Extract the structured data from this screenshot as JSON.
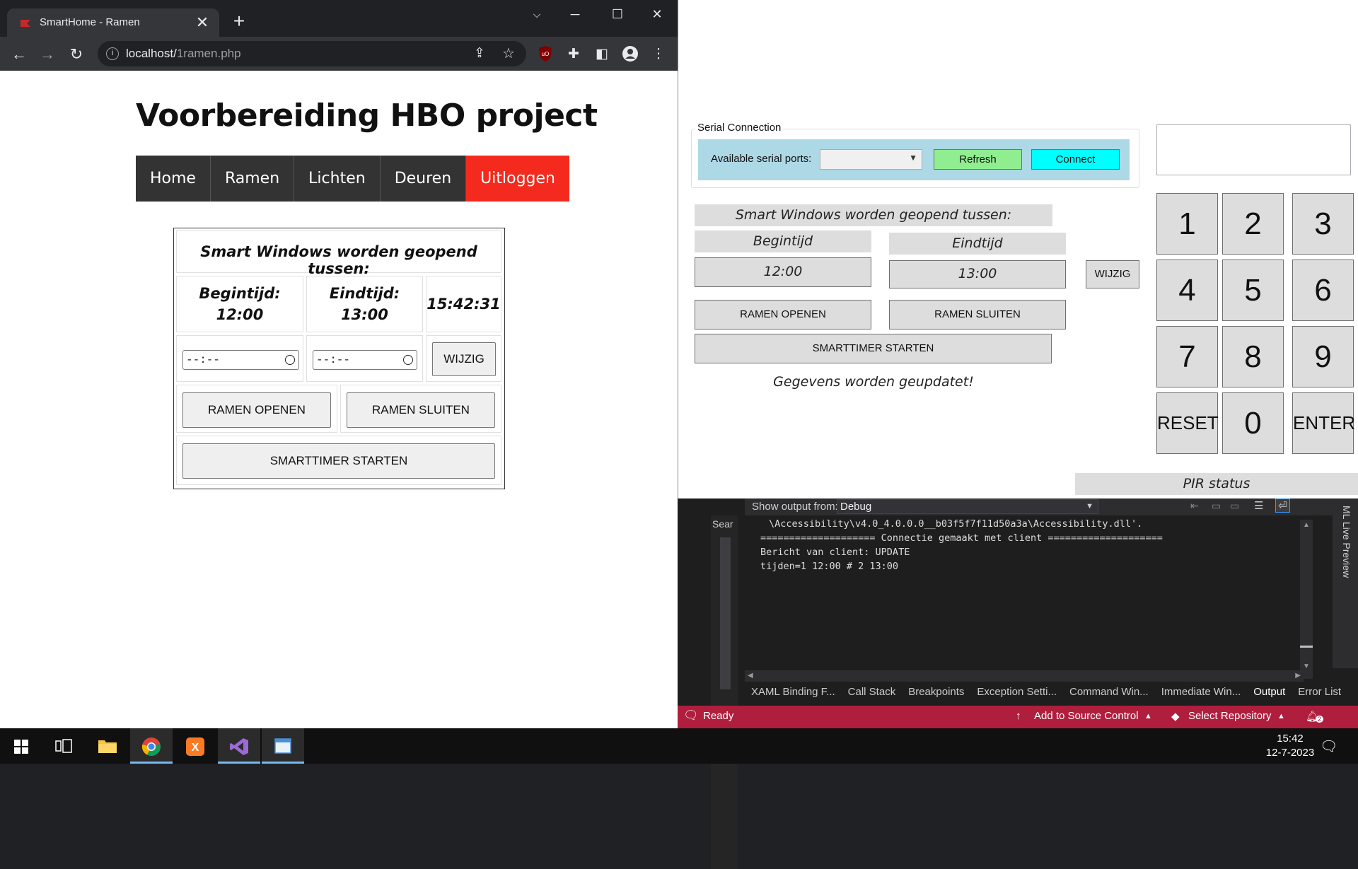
{
  "chrome": {
    "tab_title": "SmartHome - Ramen",
    "tab_close": "✕",
    "new_tab": "+",
    "url_host": "localhost/",
    "url_path": "1ramen.php"
  },
  "page": {
    "title": "Voorbereiding HBO project",
    "nav": [
      "Home",
      "Ramen",
      "Lichten",
      "Deuren",
      "Uitloggen"
    ],
    "panel_heading": "Smart Windows worden geopend tussen:",
    "begin_label": "Begintijd:",
    "begin_value": "12:00",
    "end_label": "Eindtijd:",
    "end_value": "13:00",
    "clock": "15:42:31",
    "time_placeholder": "--:--",
    "wijzig_label": "WIJZIG",
    "open_label": "RAMEN OPENEN",
    "close_label": "RAMEN SLUITEN",
    "smarttimer_label": "SMARTTIMER STARTEN"
  },
  "wpf": {
    "serial_legend": "Serial Connection",
    "serial_ports_label": "Available serial ports:",
    "refresh_label": "Refresh",
    "connect_label": "Connect",
    "heading": "Smart Windows worden geopend tussen:",
    "begin_label": "Begintijd",
    "end_label": "Eindtijd",
    "begin_value": "12:00",
    "end_value": "13:00",
    "wijzig_label": "WIJZIG",
    "open_label": "RAMEN OPENEN",
    "close_label": "RAMEN SLUITEN",
    "smarttimer_label": "SMARTTIMER STARTEN",
    "status_message": "Gegevens worden geupdatet!",
    "keypad": [
      "1",
      "2",
      "3",
      "4",
      "5",
      "6",
      "7",
      "8",
      "9",
      "RESET",
      "0",
      "ENTER"
    ],
    "pir_label": "PIR status"
  },
  "vs": {
    "show_output_label": "Show output from:",
    "output_source": "Debug",
    "search_label": "Sear",
    "output_lines": [
      "\\Accessibility\\v4.0_4.0.0.0__b03f5f7f11d50a3a\\Accessibility.dll'.",
      "==================== Connectie gemaakt met client ====================",
      "Bericht van client: UPDATE",
      "tijden=1 12:00 # 2 13:00"
    ],
    "tabs": [
      "XAML Binding F...",
      "Call Stack",
      "Breakpoints",
      "Exception Setti...",
      "Command Win...",
      "Immediate Win...",
      "Output",
      "Error List"
    ],
    "active_tab": "Output",
    "live_preview": "ML Live Preview",
    "status_ready": "Ready",
    "status_source_control": "Add to Source Control",
    "status_repository": "Select Repository",
    "notification_count": "2"
  },
  "taskbar": {
    "time": "15:42",
    "date": "12-7-2023"
  },
  "colors": {
    "logout_red": "#f42a1e",
    "serial_box": "#add8e6",
    "refresh_green": "#90ee90",
    "connect_cyan": "#00ffff",
    "vs_status": "#b01e3e"
  }
}
